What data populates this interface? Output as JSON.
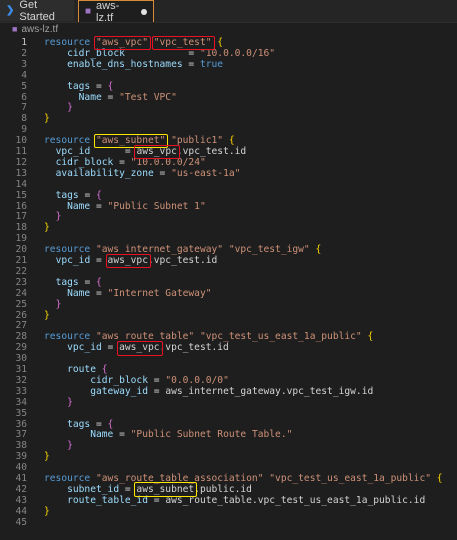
{
  "tabs": [
    {
      "label": "Get Started",
      "icon": "vscode-icon"
    },
    {
      "label": "aws-lz.tf",
      "icon": "terraform-icon",
      "modified": true
    }
  ],
  "breadcrumb": {
    "file": "aws-lz.tf"
  },
  "lines": [
    {
      "n": "1",
      "t": [
        [
          "kw",
          "resource "
        ],
        [
          "str",
          "\"aws_vpc\""
        ],
        [
          "pl",
          " "
        ],
        [
          "str",
          "\"vpc_test\""
        ],
        [
          "pl",
          " "
        ],
        [
          "br1",
          "{"
        ]
      ]
    },
    {
      "n": "2",
      "t": [
        [
          "pl",
          "    "
        ],
        [
          "attr",
          "cidr_block"
        ],
        [
          "pl",
          "           = "
        ],
        [
          "str",
          "\"10.0.0.0/16\""
        ]
      ]
    },
    {
      "n": "3",
      "t": [
        [
          "pl",
          "    "
        ],
        [
          "attr",
          "enable_dns_hostnames"
        ],
        [
          "pl",
          " = "
        ],
        [
          "kw",
          "true"
        ]
      ]
    },
    {
      "n": "4",
      "t": []
    },
    {
      "n": "5",
      "t": [
        [
          "pl",
          "    "
        ],
        [
          "attr",
          "tags"
        ],
        [
          "pl",
          " = "
        ],
        [
          "br2",
          "{"
        ]
      ]
    },
    {
      "n": "6",
      "t": [
        [
          "pl",
          "      "
        ],
        [
          "attr",
          "Name"
        ],
        [
          "pl",
          " = "
        ],
        [
          "str",
          "\"Test VPC\""
        ]
      ]
    },
    {
      "n": "7",
      "t": [
        [
          "pl",
          "    "
        ],
        [
          "br2",
          "}"
        ]
      ]
    },
    {
      "n": "8",
      "t": [
        [
          "br1",
          "}"
        ]
      ]
    },
    {
      "n": "9",
      "t": []
    },
    {
      "n": "10",
      "t": [
        [
          "kw",
          "resource "
        ],
        [
          "str",
          "\"aws_subnet\""
        ],
        [
          "pl",
          " "
        ],
        [
          "str",
          "\"public1\""
        ],
        [
          "pl",
          " "
        ],
        [
          "br1",
          "{"
        ]
      ]
    },
    {
      "n": "11",
      "t": [
        [
          "pl",
          "  "
        ],
        [
          "attr",
          "vpc_id"
        ],
        [
          "pl",
          "      = "
        ],
        [
          "pl",
          "aws_vpc.vpc_test.id"
        ]
      ]
    },
    {
      "n": "12",
      "t": [
        [
          "pl",
          "  "
        ],
        [
          "attr",
          "cidr_block"
        ],
        [
          "pl",
          " = "
        ],
        [
          "str",
          "\"10.0.0.0/24\""
        ]
      ]
    },
    {
      "n": "13",
      "t": [
        [
          "pl",
          "  "
        ],
        [
          "attr",
          "availability_zone"
        ],
        [
          "pl",
          " = "
        ],
        [
          "str",
          "\"us-east-1a\""
        ]
      ]
    },
    {
      "n": "14",
      "t": []
    },
    {
      "n": "15",
      "t": [
        [
          "pl",
          "  "
        ],
        [
          "attr",
          "tags"
        ],
        [
          "pl",
          " = "
        ],
        [
          "br2",
          "{"
        ]
      ]
    },
    {
      "n": "16",
      "t": [
        [
          "pl",
          "    "
        ],
        [
          "attr",
          "Name"
        ],
        [
          "pl",
          " = "
        ],
        [
          "str",
          "\"Public Subnet 1\""
        ]
      ]
    },
    {
      "n": "17",
      "t": [
        [
          "pl",
          "  "
        ],
        [
          "br2",
          "}"
        ]
      ]
    },
    {
      "n": "18",
      "t": [
        [
          "br1",
          "}"
        ]
      ]
    },
    {
      "n": "19",
      "t": []
    },
    {
      "n": "20",
      "t": [
        [
          "kw",
          "resource "
        ],
        [
          "str",
          "\"aws_internet_gateway\""
        ],
        [
          "pl",
          " "
        ],
        [
          "str",
          "\"vpc_test_igw\""
        ],
        [
          "pl",
          " "
        ],
        [
          "br1",
          "{"
        ]
      ]
    },
    {
      "n": "21",
      "t": [
        [
          "pl",
          "  "
        ],
        [
          "attr",
          "vpc_id"
        ],
        [
          "pl",
          " = "
        ],
        [
          "pl",
          "aws_vpc.vpc_test.id"
        ]
      ]
    },
    {
      "n": "22",
      "t": []
    },
    {
      "n": "23",
      "t": [
        [
          "pl",
          "  "
        ],
        [
          "attr",
          "tags"
        ],
        [
          "pl",
          " = "
        ],
        [
          "br2",
          "{"
        ]
      ]
    },
    {
      "n": "24",
      "t": [
        [
          "pl",
          "    "
        ],
        [
          "attr",
          "Name"
        ],
        [
          "pl",
          " = "
        ],
        [
          "str",
          "\"Internet Gateway\""
        ]
      ]
    },
    {
      "n": "25",
      "t": [
        [
          "pl",
          "  "
        ],
        [
          "br2",
          "}"
        ]
      ]
    },
    {
      "n": "26",
      "t": [
        [
          "br1",
          "}"
        ]
      ]
    },
    {
      "n": "27",
      "t": []
    },
    {
      "n": "28",
      "t": [
        [
          "kw",
          "resource "
        ],
        [
          "str",
          "\"aws_route_table\""
        ],
        [
          "pl",
          " "
        ],
        [
          "str",
          "\"vpc_test_us_east_1a_public\""
        ],
        [
          "pl",
          " "
        ],
        [
          "br1",
          "{"
        ]
      ]
    },
    {
      "n": "29",
      "t": [
        [
          "pl",
          "    "
        ],
        [
          "attr",
          "vpc_id"
        ],
        [
          "pl",
          " = "
        ],
        [
          "pl",
          "aws_vpc.vpc_test.id"
        ]
      ]
    },
    {
      "n": "30",
      "t": []
    },
    {
      "n": "31",
      "t": [
        [
          "pl",
          "    "
        ],
        [
          "attr",
          "route"
        ],
        [
          "pl",
          " "
        ],
        [
          "br2",
          "{"
        ]
      ]
    },
    {
      "n": "32",
      "t": [
        [
          "pl",
          "        "
        ],
        [
          "attr",
          "cidr_block"
        ],
        [
          "pl",
          " = "
        ],
        [
          "str",
          "\"0.0.0.0/0\""
        ]
      ]
    },
    {
      "n": "33",
      "t": [
        [
          "pl",
          "        "
        ],
        [
          "attr",
          "gateway_id"
        ],
        [
          "pl",
          " = "
        ],
        [
          "pl",
          "aws_internet_gateway.vpc_test_igw.id"
        ]
      ]
    },
    {
      "n": "34",
      "t": [
        [
          "pl",
          "    "
        ],
        [
          "br2",
          "}"
        ]
      ]
    },
    {
      "n": "35",
      "t": []
    },
    {
      "n": "36",
      "t": [
        [
          "pl",
          "    "
        ],
        [
          "attr",
          "tags"
        ],
        [
          "pl",
          " = "
        ],
        [
          "br2",
          "{"
        ]
      ]
    },
    {
      "n": "37",
      "t": [
        [
          "pl",
          "        "
        ],
        [
          "attr",
          "Name"
        ],
        [
          "pl",
          " = "
        ],
        [
          "str",
          "\"Public Subnet Route Table.\""
        ]
      ]
    },
    {
      "n": "38",
      "t": [
        [
          "pl",
          "    "
        ],
        [
          "br2",
          "}"
        ]
      ]
    },
    {
      "n": "39",
      "t": [
        [
          "br1",
          "}"
        ]
      ]
    },
    {
      "n": "40",
      "t": []
    },
    {
      "n": "41",
      "t": [
        [
          "kw",
          "resource "
        ],
        [
          "str",
          "\"aws_route_table_association\""
        ],
        [
          "pl",
          " "
        ],
        [
          "str",
          "\"vpc_test_us_east_1a_public\""
        ],
        [
          "pl",
          " "
        ],
        [
          "br1",
          "{"
        ]
      ]
    },
    {
      "n": "42",
      "t": [
        [
          "pl",
          "    "
        ],
        [
          "attr",
          "subnet_id"
        ],
        [
          "pl",
          " = "
        ],
        [
          "pl",
          "aws_subnet.public.id"
        ]
      ]
    },
    {
      "n": "43",
      "t": [
        [
          "pl",
          "    "
        ],
        [
          "attr",
          "route_table_id"
        ],
        [
          "pl",
          " = "
        ],
        [
          "pl",
          "aws_route_table.vpc_test_us_east_1a_public.id"
        ]
      ]
    },
    {
      "n": "44",
      "t": [
        [
          "br1",
          "}"
        ]
      ]
    },
    {
      "n": "45",
      "t": []
    }
  ],
  "colors": {
    "keyword": "#569cd6",
    "string": "#ce9178",
    "attribute": "#9cdcfe",
    "annotation_red": "#e81123",
    "annotation_yellow": "#ffe600"
  }
}
